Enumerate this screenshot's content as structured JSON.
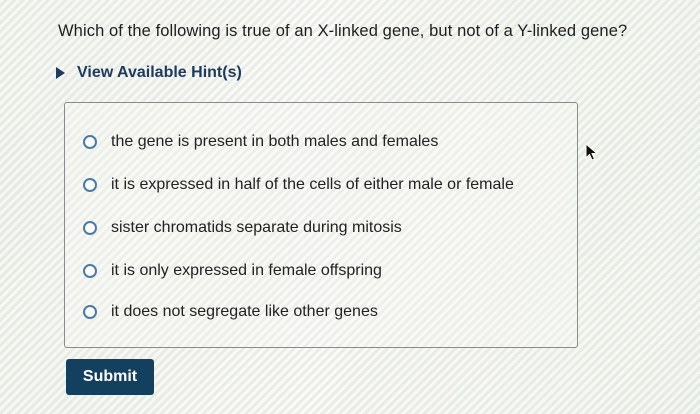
{
  "question": {
    "text": "Which of the following is true of an X-linked gene, but not of a Y-linked gene?"
  },
  "hint": {
    "label": "View Available Hint(s)",
    "icon": "triangle-right-icon"
  },
  "options": [
    {
      "label": "the gene is present in both males and females",
      "selected": false
    },
    {
      "label": "it is expressed in half of the cells of either male or female",
      "selected": false
    },
    {
      "label": "sister chromatids separate during mitosis",
      "selected": false
    },
    {
      "label": "it is only expressed in female offspring",
      "selected": false
    },
    {
      "label": "it does not segregate like other genes",
      "selected": false
    }
  ],
  "submit": {
    "label": "Submit"
  },
  "colors": {
    "accent": "#14405f",
    "hint_text": "#1f3a5c",
    "radio_border": "#4c7aa6"
  }
}
